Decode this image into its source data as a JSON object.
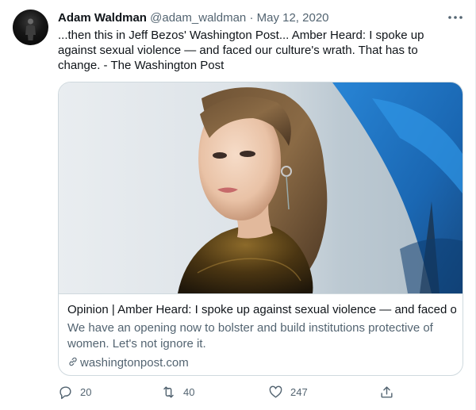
{
  "tweet": {
    "author_name": "Adam Waldman",
    "handle": "@adam_waldman",
    "separator": "·",
    "date": "May 12, 2020",
    "text": "...then this in Jeff Bezos' Washington Post... Amber Heard: I spoke up against sexual violence — and faced our culture's wrath. That has to change. - The Washington Post"
  },
  "card": {
    "title": "Opinion | Amber Heard: I spoke up against sexual violence — and faced our ...",
    "description": "We have an opening now to bolster and build institutions protective of women. Let's not ignore it.",
    "domain": "washingtonpost.com",
    "icon": "link-icon"
  },
  "actions": {
    "reply_count": "20",
    "retweet_count": "40",
    "like_count": "247"
  },
  "colors": {
    "text_primary": "#0f1419",
    "text_secondary": "#536471",
    "border": "#cfd9de"
  }
}
